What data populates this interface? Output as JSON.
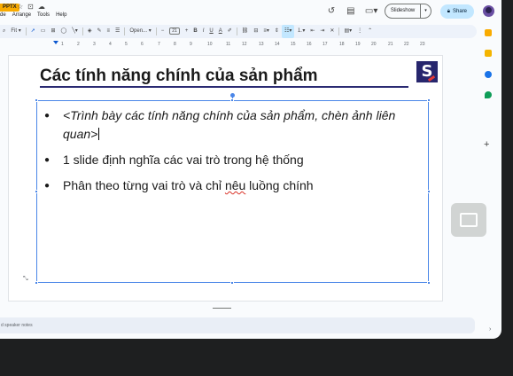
{
  "titlebar": {
    "badge": "PPTX",
    "icons": [
      "star-icon",
      "move-to-folder-icon",
      "cloud-status-icon"
    ]
  },
  "menu": [
    "de",
    "Arrange",
    "Tools",
    "Help"
  ],
  "top_right": {
    "slideshow_label": "Slideshow",
    "share_label": "Share"
  },
  "toolbar": {
    "zoom": "Fit",
    "font": "Open...",
    "font_size": "21",
    "minus": "−",
    "plus": "+",
    "bold": "B",
    "italic": "I",
    "underline": "U",
    "text_color": "A"
  },
  "ruler": {
    "ticks": [
      "1",
      "2",
      "3",
      "4",
      "5",
      "6",
      "7",
      "8",
      "9",
      "10",
      "11",
      "12",
      "13",
      "14",
      "15",
      "16",
      "17",
      "18",
      "19",
      "20",
      "21",
      "22",
      "23"
    ]
  },
  "slide": {
    "title": "Các tính năng chính của sản phẩm",
    "bullets": {
      "b1": "<Trình bày các tính năng chính của sản phẩm, chèn ảnh liên quan>",
      "b2": "1 slide định nghĩa các vai trò trong hệ thống",
      "b3_pre": "Phân theo từng vai trò và chỉ ",
      "b3_spell": "nêu",
      "b3_post": " luồng chính"
    }
  },
  "notes": {
    "placeholder": "d speaker notes"
  },
  "colors": {
    "accent": "#0b57d0",
    "share_bg": "#c2e7ff",
    "selection": "#4a86e8",
    "title_rule": "#2a2a72",
    "logo_bg": "#27266d"
  }
}
